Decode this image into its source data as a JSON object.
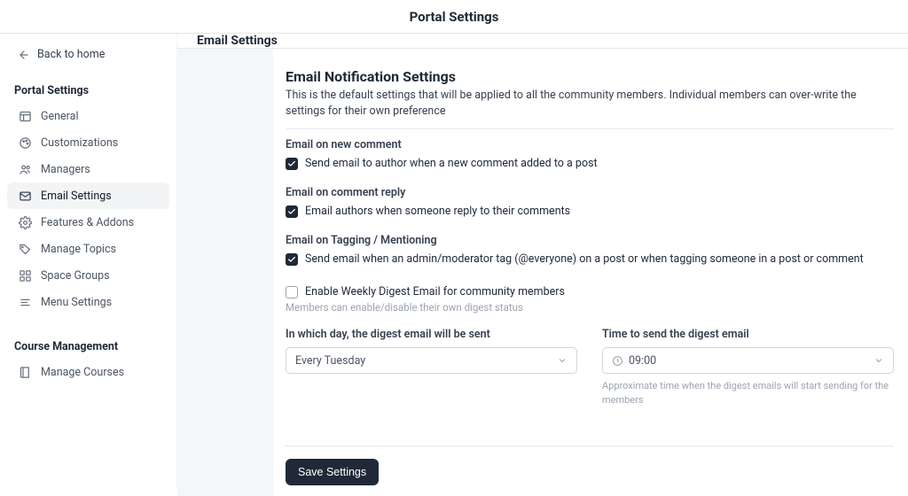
{
  "header": {
    "title": "Portal Settings"
  },
  "sidebar": {
    "back_label": "Back to home",
    "group1_title": "Portal Settings",
    "items1": [
      {
        "label": "General"
      },
      {
        "label": "Customizations"
      },
      {
        "label": "Managers"
      },
      {
        "label": "Email Settings"
      },
      {
        "label": "Features & Addons"
      },
      {
        "label": "Manage Topics"
      },
      {
        "label": "Space Groups"
      },
      {
        "label": "Menu Settings"
      }
    ],
    "group2_title": "Course Management",
    "items2": [
      {
        "label": "Manage Courses"
      }
    ]
  },
  "content": {
    "header": "Email Settings",
    "panel_title": "Email Notification Settings",
    "panel_desc": "This is the default settings that will be applied to all the community members. Individual members can over-write the settings for their own preference",
    "group_new_comment": {
      "label": "Email on new comment",
      "desc": "Send email to author when a new comment added to a post"
    },
    "group_comment_reply": {
      "label": "Email on comment reply",
      "desc": "Email authors when someone reply to their comments"
    },
    "group_tagging": {
      "label": "Email on Tagging / Mentioning",
      "desc": "Send email when an admin/moderator tag (@everyone) on a post or when tagging someone in a post or comment"
    },
    "group_digest": {
      "label": "Enable Weekly Digest Email for community members",
      "hint": "Members can enable/disable their own digest status"
    },
    "digest_day": {
      "label": "In which day, the digest email will be sent",
      "value": "Every Tuesday"
    },
    "digest_time": {
      "label": "Time to send the digest email",
      "value": "09:00",
      "hint": "Approximate time when the digest emails will start sending for the members"
    },
    "save_label": "Save Settings"
  }
}
